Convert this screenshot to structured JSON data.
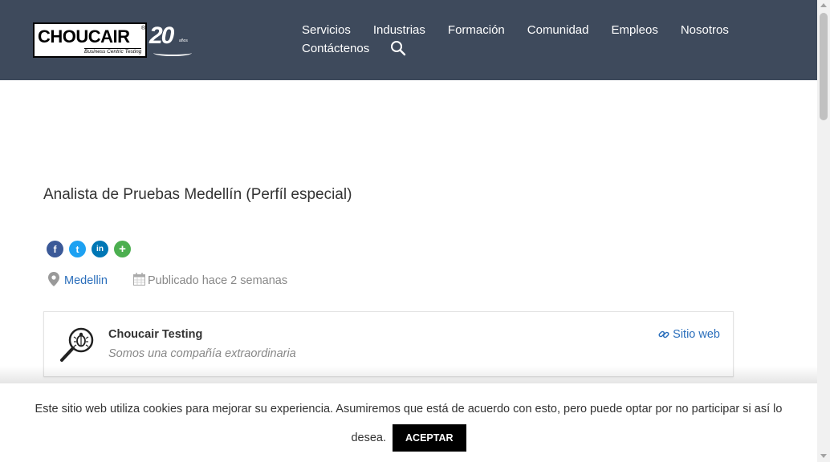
{
  "header": {
    "logo": {
      "brand": "CHOUCAIR",
      "registered": "®",
      "tagline": "Business Centric Testing",
      "anniversary": "20",
      "anniversary_sub": "años"
    },
    "nav_row1": [
      "Servicios",
      "Industrias",
      "Formación",
      "Comunidad",
      "Empleos",
      "Nosotros"
    ],
    "nav_row2": [
      "Contáctenos"
    ],
    "search_icon": "search-icon"
  },
  "job": {
    "title": "Analista de Pruebas Medellín (Perfíl especial)",
    "share_buttons": [
      {
        "name": "facebook",
        "glyph": "f",
        "color": "#3b5998"
      },
      {
        "name": "twitter",
        "glyph": "t",
        "color": "#1da1f2"
      },
      {
        "name": "linkedin",
        "glyph": "in",
        "color": "#0077b5"
      },
      {
        "name": "more",
        "glyph": "+",
        "color": "#4caf50"
      }
    ],
    "location": "Medellin",
    "published": "Publicado hace 2 semanas"
  },
  "company": {
    "name": "Choucair Testing",
    "tagline": "Somos una compañía extraordinaria",
    "website_label": "Sitio web"
  },
  "cookie": {
    "message": "Este sitio web utiliza cookies para mejorar su experiencia. Asumiremos que está de acuerdo con esto, pero puede optar por no participar si así lo desea.",
    "accept_label": "ACEPTAR"
  },
  "colors": {
    "header_bg": "#3e4a5c",
    "link": "#2a6ebb",
    "accept_bg": "#000000"
  }
}
